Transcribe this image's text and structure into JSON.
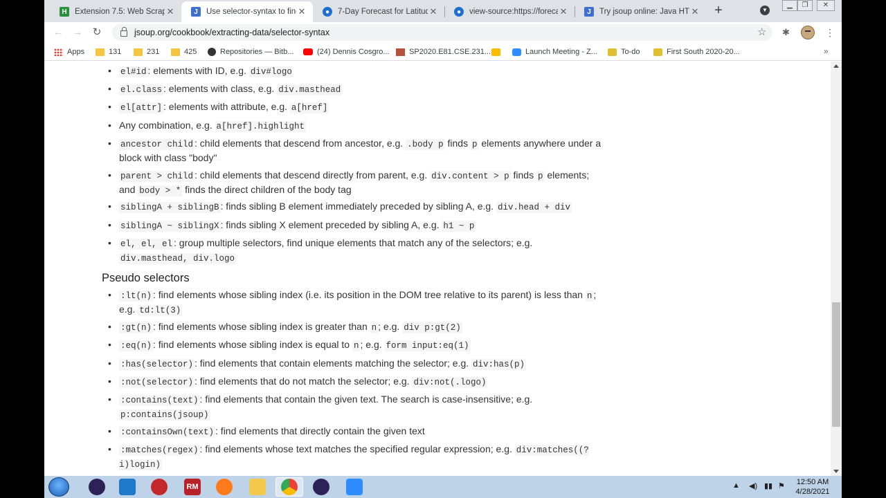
{
  "tabs": [
    {
      "title": "Extension 7.5: Web Scraper",
      "icon": "hackerrank-icon"
    },
    {
      "title": "Use selector-syntax to find",
      "icon": "jsoup-icon"
    },
    {
      "title": "7-Day Forecast for Latitude",
      "icon": "nws-icon"
    },
    {
      "title": "view-source:https://foreca",
      "icon": "nws-icon"
    },
    {
      "title": "Try jsoup online: Java HTM",
      "icon": "jsoup-icon"
    }
  ],
  "tab_close": "✕",
  "new_tab": "+",
  "url": "jsoup.org/cookbook/extracting-data/selector-syntax",
  "bookmarks": [
    {
      "label": "Apps",
      "icon": "apps-icon"
    },
    {
      "label": "131",
      "icon": "folder-icon"
    },
    {
      "label": "231",
      "icon": "folder-icon"
    },
    {
      "label": "425",
      "icon": "folder-icon"
    },
    {
      "label": "Repositories — Bitb...",
      "icon": "github-icon"
    },
    {
      "label": "(24) Dennis Cosgro...",
      "icon": "youtube-icon"
    },
    {
      "label": "SP2020.E81.CSE.231...",
      "icon": "site-icon"
    },
    {
      "label": "",
      "icon": "note-icon"
    },
    {
      "label": "Launch Meeting - Z...",
      "icon": "zoom-icon"
    },
    {
      "label": "To-do",
      "icon": "classroom-icon"
    },
    {
      "label": "First South 2020-20...",
      "icon": "classroom-icon"
    }
  ],
  "items_top": [
    {
      "parts": [
        [
          "c",
          "el#id"
        ],
        [
          "t",
          ": elements with ID, e.g. "
        ],
        [
          "c",
          "div#logo"
        ]
      ]
    },
    {
      "parts": [
        [
          "c",
          "el.class"
        ],
        [
          "t",
          ": elements with class, e.g. "
        ],
        [
          "c",
          "div.masthead"
        ]
      ]
    },
    {
      "parts": [
        [
          "c",
          "el[attr]"
        ],
        [
          "t",
          ": elements with attribute, e.g. "
        ],
        [
          "c",
          "a[href]"
        ]
      ]
    },
    {
      "parts": [
        [
          "t",
          "Any combination, e.g. "
        ],
        [
          "c",
          "a[href].highlight"
        ]
      ]
    },
    {
      "parts": [
        [
          "c",
          "ancestor child"
        ],
        [
          "t",
          ": child elements that descend from ancestor, e.g. "
        ],
        [
          "c",
          ".body p"
        ],
        [
          "t",
          " finds "
        ],
        [
          "c",
          "p"
        ],
        [
          "t",
          " elements anywhere under a block with class \"body\""
        ]
      ]
    },
    {
      "parts": [
        [
          "c",
          "parent > child"
        ],
        [
          "t",
          ": child elements that descend directly from parent, e.g. "
        ],
        [
          "c",
          "div.content > p"
        ],
        [
          "t",
          " finds "
        ],
        [
          "c",
          "p"
        ],
        [
          "t",
          " elements; and "
        ],
        [
          "c",
          "body > *"
        ],
        [
          "t",
          " finds the direct children of the body tag"
        ]
      ]
    },
    {
      "parts": [
        [
          "c",
          "siblingA + siblingB"
        ],
        [
          "t",
          ": finds sibling B element immediately preceded by sibling A, e.g. "
        ],
        [
          "c",
          "div.head + div"
        ]
      ]
    },
    {
      "parts": [
        [
          "c",
          "siblingA ~ siblingX"
        ],
        [
          "t",
          ": finds sibling X element preceded by sibling A, e.g. "
        ],
        [
          "c",
          "h1 ~ p"
        ]
      ]
    },
    {
      "parts": [
        [
          "c",
          "el, el, el"
        ],
        [
          "t",
          ": group multiple selectors, find unique elements that match any of the selectors; e.g. "
        ],
        [
          "c",
          "div.masthead, div.logo"
        ]
      ]
    }
  ],
  "pseudo_heading": "Pseudo selectors",
  "items_pseudo": [
    {
      "parts": [
        [
          "c",
          ":lt(n)"
        ],
        [
          "t",
          ": find elements whose sibling index (i.e. its position in the DOM tree relative to its parent) is less than "
        ],
        [
          "c",
          "n"
        ],
        [
          "t",
          "; e.g. "
        ],
        [
          "c",
          "td:lt(3)"
        ]
      ]
    },
    {
      "parts": [
        [
          "c",
          ":gt(n)"
        ],
        [
          "t",
          ": find elements whose sibling index is greater than "
        ],
        [
          "c",
          "n"
        ],
        [
          "t",
          "; e.g. "
        ],
        [
          "c",
          "div p:gt(2)"
        ]
      ]
    },
    {
      "parts": [
        [
          "c",
          ":eq(n)"
        ],
        [
          "t",
          ": find elements whose sibling index is equal to "
        ],
        [
          "c",
          "n"
        ],
        [
          "t",
          "; e.g. "
        ],
        [
          "c",
          "form input:eq(1)"
        ]
      ]
    },
    {
      "parts": [
        [
          "c",
          ":has(selector)"
        ],
        [
          "t",
          ": find elements that contain elements matching the selector; e.g. "
        ],
        [
          "c",
          "div:has(p)"
        ]
      ]
    },
    {
      "parts": [
        [
          "c",
          ":not(selector)"
        ],
        [
          "t",
          ": find elements that do not match the selector; e.g. "
        ],
        [
          "c",
          "div:not(.logo)"
        ]
      ]
    },
    {
      "parts": [
        [
          "c",
          ":contains(text)"
        ],
        [
          "t",
          ": find elements that contain the given text. The search is case-insensitive; e.g. "
        ],
        [
          "c",
          "p:contains(jsoup)"
        ]
      ]
    },
    {
      "parts": [
        [
          "c",
          ":containsOwn(text)"
        ],
        [
          "t",
          ": find elements that directly contain the given text"
        ]
      ]
    },
    {
      "parts": [
        [
          "c",
          ":matches(regex)"
        ],
        [
          "t",
          ": find elements whose text matches the specified regular expression; e.g. "
        ],
        [
          "c",
          "div:matches((?i)login)"
        ]
      ]
    }
  ],
  "taskbar": {
    "apps": [
      "eclipse-icon",
      "vscode-icon",
      "racket-icon",
      "rm-icon",
      "firefox-icon",
      "explorer-icon",
      "chrome-icon",
      "eclipse-icon",
      "zoom-icon"
    ],
    "rm_label": "RM",
    "time": "12:50 AM",
    "date": "4/28/2021"
  },
  "colors": {
    "code_bg": "#f5f5f5",
    "text": "#333333",
    "tabstrip": "#dee1e6",
    "taskbar": "#bfd3e8"
  }
}
